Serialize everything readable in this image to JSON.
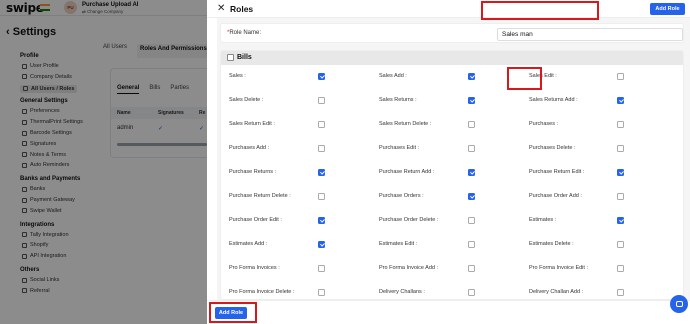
{
  "app": {
    "logo": "swipe",
    "company_avatar": "PU",
    "company_name": "Purchase Upload AI",
    "change_company": "⇄ Change Company",
    "settings_title": "Settings",
    "back_icon": "chevron-left-icon"
  },
  "sidebar": {
    "groups": [
      {
        "label": "Profile",
        "items": [
          "User Profile",
          "Company Details",
          "All Users / Roles"
        ]
      },
      {
        "label": "General Settings",
        "items": [
          "Preferences",
          "ThermalPrint Settings",
          "Barcode Settings",
          "Signatures",
          "Notes & Terms",
          "Auto Reminders"
        ]
      },
      {
        "label": "Banks and Payments",
        "items": [
          "Banks",
          "Payment Gateway",
          "Swipe Wallet"
        ]
      },
      {
        "label": "Integrations",
        "items": [
          "Tally Integration",
          "Shopify",
          "API Integration"
        ]
      },
      {
        "label": "Others",
        "items": [
          "Social Links",
          "Referral"
        ]
      }
    ]
  },
  "bg_tabs": [
    "All Users",
    "Roles And Permissions"
  ],
  "bg_subtabs": [
    "General",
    "Bills",
    "Parties"
  ],
  "bg_table": {
    "headers": [
      "Name",
      "Signatures",
      "Re"
    ],
    "row_name": "admin"
  },
  "drawer": {
    "title": "Roles",
    "add_role_header": "Add Role",
    "role_name_required": "*",
    "role_name_label": "Role Name:",
    "role_name_value": "Sales man",
    "section_title": "Bills",
    "add_role_footer": "Add Role"
  },
  "permissions": [
    [
      {
        "label": "Sales :",
        "checked": true
      },
      {
        "label": "Sales Add :",
        "checked": true
      },
      {
        "label": "Sales Edit :",
        "checked": false
      }
    ],
    [
      {
        "label": "Sales Delete :",
        "checked": false
      },
      {
        "label": "Sales Returns :",
        "checked": true
      },
      {
        "label": "Sales Returns Add :",
        "checked": true
      }
    ],
    [
      {
        "label": "Sales Return Edit :",
        "checked": false
      },
      {
        "label": "Sales Return Delete :",
        "checked": false
      },
      {
        "label": "Purchases :",
        "checked": false
      }
    ],
    [
      {
        "label": "Purchases Add :",
        "checked": false
      },
      {
        "label": "Purchases Edit :",
        "checked": false
      },
      {
        "label": "Purchases Delete :",
        "checked": false
      }
    ],
    [
      {
        "label": "Purchase Returns :",
        "checked": true
      },
      {
        "label": "Purchase Return Add :",
        "checked": true
      },
      {
        "label": "Purchase Return Edit :",
        "checked": true
      }
    ],
    [
      {
        "label": "Purchase Return Delete :",
        "checked": false
      },
      {
        "label": "Purchase Orders :",
        "checked": true
      },
      {
        "label": "Purchase Order Add :",
        "checked": false
      }
    ],
    [
      {
        "label": "Purchase Order Edit :",
        "checked": true
      },
      {
        "label": "Purchase Order Delete :",
        "checked": false
      },
      {
        "label": "Estimates :",
        "checked": true
      }
    ],
    [
      {
        "label": "Estimates Add :",
        "checked": true
      },
      {
        "label": "Estimates Edit :",
        "checked": false
      },
      {
        "label": "Estimates Delete :",
        "checked": false
      }
    ],
    [
      {
        "label": "Pro Forma Invoices :",
        "checked": false
      },
      {
        "label": "Pro Forma Invoice Add :",
        "checked": false
      },
      {
        "label": "Pro Forma Invoice Edit :",
        "checked": false
      }
    ],
    [
      {
        "label": "Pro Forma Invoice Delete :",
        "checked": false
      },
      {
        "label": "Delivery Challans :",
        "checked": false
      },
      {
        "label": "Delivery Challan Add :",
        "checked": false
      }
    ]
  ],
  "colors": {
    "accent": "#2563eb",
    "highlight": "#d7191c"
  },
  "icons": {
    "close": "close-icon",
    "chat": "chat-bubble-icon",
    "check": "check-icon"
  }
}
